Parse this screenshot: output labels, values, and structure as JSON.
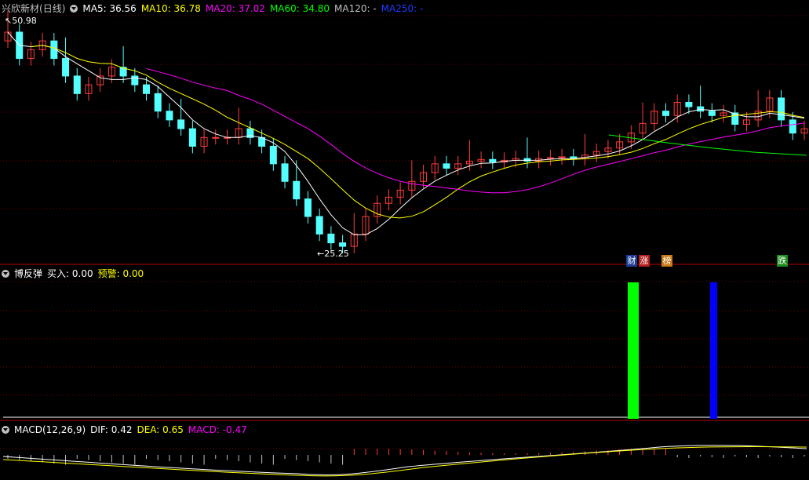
{
  "price_panel": {
    "stock_name": "兴欣新材",
    "period": "(日线)",
    "ma": [
      {
        "name": "MA5",
        "label": "MA5: ",
        "value": "36.56",
        "color": "#ffffff"
      },
      {
        "name": "MA10",
        "label": "MA10: ",
        "value": "36.78",
        "color": "#ffff00"
      },
      {
        "name": "MA20",
        "label": "MA20: ",
        "value": "37.02",
        "color": "#ff00ff"
      },
      {
        "name": "MA60",
        "label": "MA60: ",
        "value": "34.80",
        "color": "#00ff00"
      },
      {
        "name": "MA120",
        "label": "MA120: ",
        "value": "-",
        "color": "#c0c0c0"
      },
      {
        "name": "MA250",
        "label": "MA250: ",
        "value": "-",
        "color": "#1e3cff"
      }
    ],
    "high_label": "50.98",
    "low_label": "25.25",
    "badges": [
      {
        "text": "财",
        "bg": "#1e3c96"
      },
      {
        "text": "涨",
        "bg": "#b41e1e"
      },
      {
        "text": "榜",
        "bg": "#c87814"
      },
      {
        "text": "跌",
        "bg": "#1e8c1e"
      }
    ]
  },
  "indicator_panel": {
    "name": "博反弹",
    "buy_label": "买入: ",
    "buy_value": "0.00",
    "warn_label": "预警: ",
    "warn_value": "0.00",
    "buy_color": "#00ff00",
    "warn_color": "#0000ff"
  },
  "macd_panel": {
    "name": "MACD(12,26,9)",
    "dif_label": "DIF: ",
    "dif_value": "0.42",
    "dea_label": "DEA: ",
    "dea_value": "0.65",
    "macd_label": "MACD: ",
    "macd_value": "-0.47"
  },
  "colors": {
    "up": "#ff3c3c",
    "down": "#54ffff",
    "grid": "#7a0000",
    "divider": "#b40000"
  }
}
